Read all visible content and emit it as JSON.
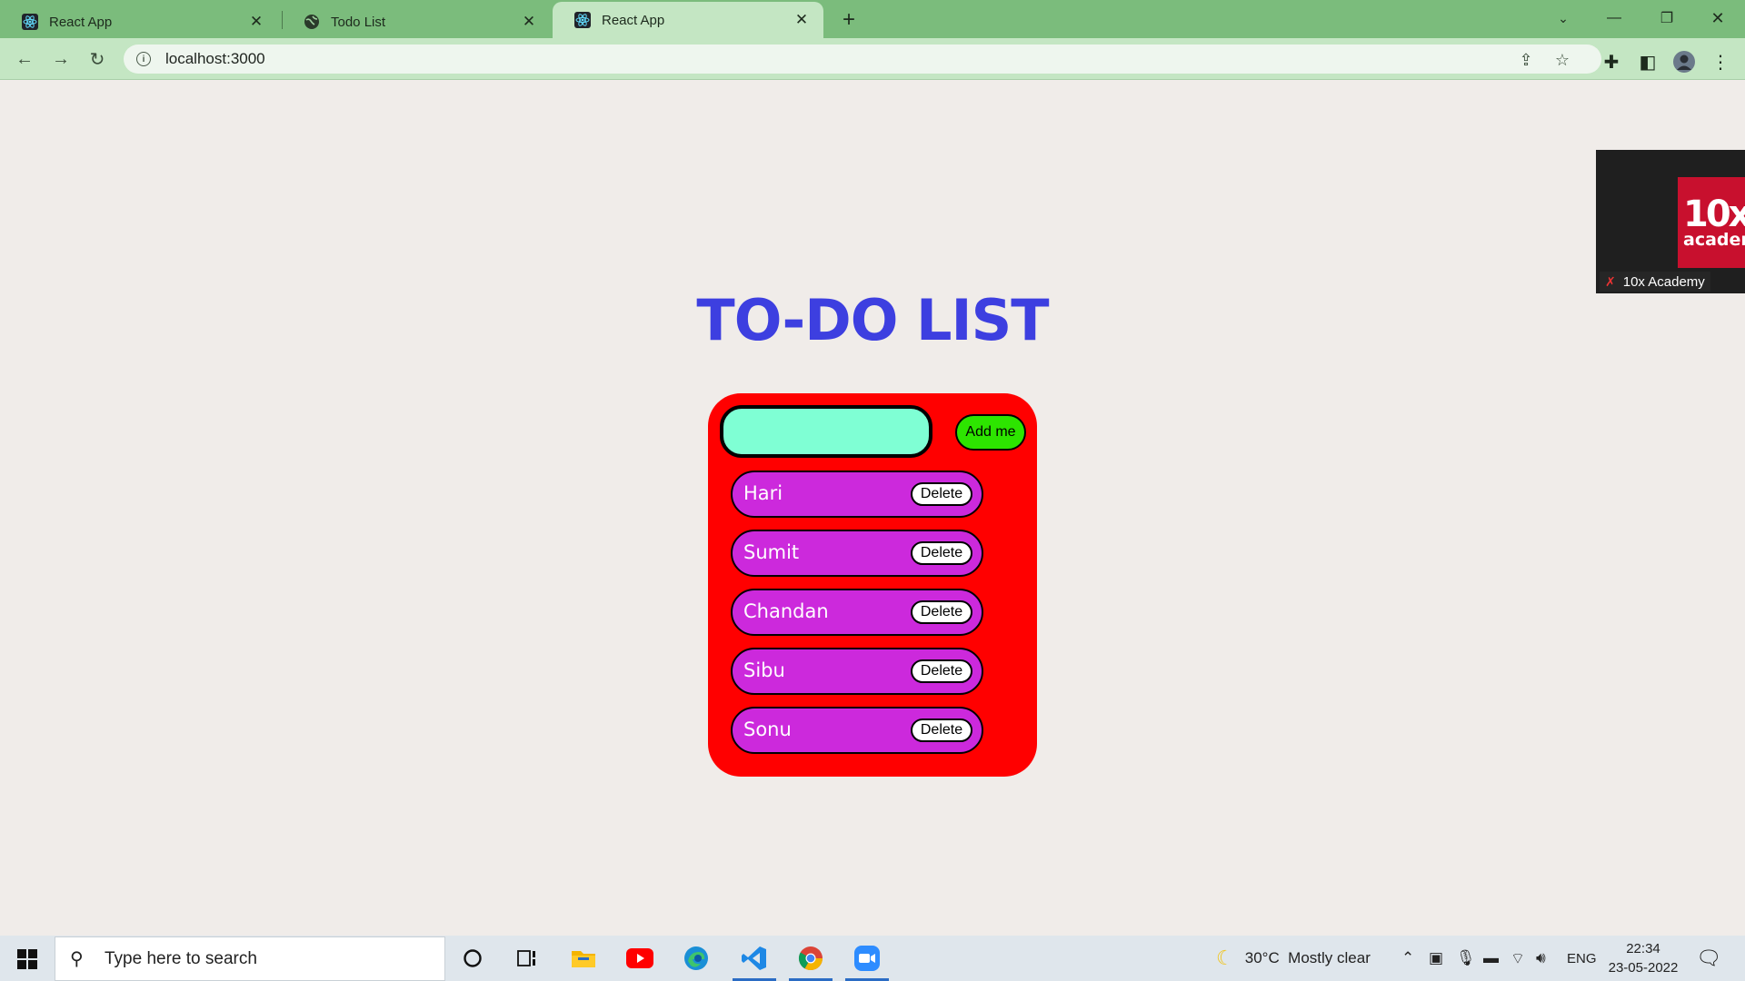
{
  "browser": {
    "tabs": [
      {
        "title": "React App",
        "icon": "react-icon"
      },
      {
        "title": "Todo List",
        "icon": "globe-icon"
      },
      {
        "title": "React App",
        "icon": "react-icon"
      }
    ],
    "active_tab": 2,
    "url": "localhost:3000"
  },
  "page": {
    "heading": "TO-DO LIST",
    "input_value": "",
    "add_button_label": "Add me",
    "delete_label": "Delete",
    "items": [
      "Hari",
      "Sumit",
      "Chandan",
      "Sibu",
      "Sonu"
    ],
    "colors": {
      "heading": "#3d3fe0",
      "card": "#ff0000",
      "input": "#7fffd4",
      "add_button": "#2de500",
      "item": "#cc29dc"
    }
  },
  "zoom_overlay": {
    "participant": "10x Academy",
    "logo_big": "10x",
    "logo_small": "academy"
  },
  "taskbar": {
    "search_placeholder": "Type here to search",
    "weather": "30°C  Mostly clear",
    "language": "ENG",
    "time": "22:34",
    "date": "23-05-2022"
  }
}
